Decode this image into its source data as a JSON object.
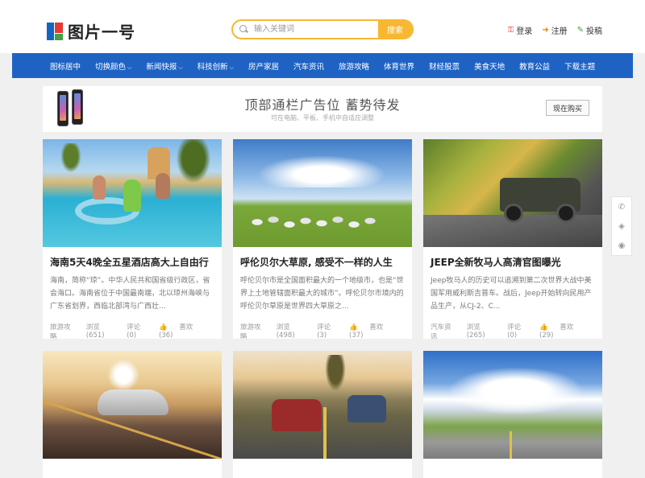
{
  "header": {
    "logo_text": "图片一号",
    "search_placeholder": "输入关键词",
    "search_button": "搜索",
    "login": "登录",
    "register": "注册",
    "submit": "投稿"
  },
  "nav": {
    "items": [
      {
        "label": "图标居中",
        "has_caret": false
      },
      {
        "label": "切换颜色",
        "has_caret": true
      },
      {
        "label": "新闻快报",
        "has_caret": true
      },
      {
        "label": "科技创新",
        "has_caret": true
      },
      {
        "label": "房产家居",
        "has_caret": false
      },
      {
        "label": "汽车资讯",
        "has_caret": false
      },
      {
        "label": "旅游攻略",
        "has_caret": false
      },
      {
        "label": "体育世界",
        "has_caret": false
      },
      {
        "label": "财经股票",
        "has_caret": false
      },
      {
        "label": "美食天地",
        "has_caret": false
      },
      {
        "label": "教育公益",
        "has_caret": false
      },
      {
        "label": "下载主题",
        "has_caret": false
      }
    ]
  },
  "ad": {
    "title": "顶部通栏广告位  蓄势待发",
    "subtitle": "可在电脑、平板、手机中自适应调整",
    "button": "现在购买"
  },
  "cards": [
    {
      "image": "pool",
      "title": "海南5天4晚全五星酒店高大上自由行",
      "desc": "海南，简称“琼”。中华人民共和国省级行政区，省会海口。海南省位于中国最南端，北以琼州海峡与广东省划界，西临北部湾与广西壮...",
      "category": "旅游攻略",
      "views": "浏览(651)",
      "comments": "评论(0)",
      "likes": "喜欢(36)"
    },
    {
      "image": "grass",
      "title": "呼伦贝尔大草原, 感受不一样的人生",
      "desc": "呼伦贝尔市是全国面积最大的一个地级市，也是“世界上土地管辖面积最大的城市”。呼伦贝尔市境内的呼伦贝尔草原是世界四大草原之...",
      "category": "旅游攻略",
      "views": "浏览(498)",
      "comments": "评论(3)",
      "likes": "喜欢(37)"
    },
    {
      "image": "jeep",
      "title": "JEEP全新牧马人高清官图曝光",
      "desc": "Jeep牧马人的历史可以追溯到第二次世界大战中美国军用威利斯吉普车。战后，Jeep开始转向民用产品生产，从CJ-2、C...",
      "category": "汽车资讯",
      "views": "浏览(265)",
      "comments": "评论(0)",
      "likes": "喜欢(29)"
    },
    {
      "image": "tesla",
      "title": "",
      "desc": "",
      "category": "",
      "views": "",
      "comments": "",
      "likes": ""
    },
    {
      "image": "road",
      "title": "",
      "desc": "",
      "category": "",
      "views": "",
      "comments": "",
      "likes": ""
    },
    {
      "image": "sky",
      "title": "",
      "desc": "",
      "category": "",
      "views": "",
      "comments": "",
      "likes": ""
    }
  ],
  "icons": {
    "login": "user-icon",
    "register": "register-icon",
    "submit": "edit-icon",
    "like": "thumb-up-icon",
    "float": [
      "phone-icon",
      "wechat-icon",
      "weibo-icon"
    ]
  },
  "colors": {
    "nav_bg": "#1e63c4",
    "search_accent": "#f7b731",
    "page_bg": "#f0f0f0"
  }
}
